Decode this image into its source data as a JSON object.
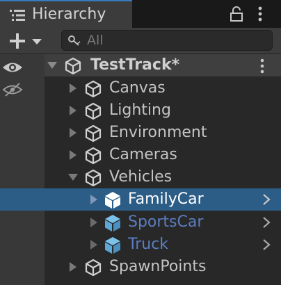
{
  "tab": {
    "title": "Hierarchy"
  },
  "search": {
    "placeholder": "All"
  },
  "scene": {
    "name": "TestTrack*"
  },
  "items": [
    {
      "label": "Canvas"
    },
    {
      "label": "Lighting"
    },
    {
      "label": "Environment"
    },
    {
      "label": "Cameras"
    },
    {
      "label": "Vehicles"
    },
    {
      "label": "FamilyCar"
    },
    {
      "label": "SportsCar"
    },
    {
      "label": "Truck"
    },
    {
      "label": "SpawnPoints"
    }
  ],
  "colors": {
    "selection": "#2c5d87",
    "prefab_blue": "#5b7ec0",
    "prefab_icon": "#7cc1ea",
    "accent_tab": "#3a79bb"
  }
}
